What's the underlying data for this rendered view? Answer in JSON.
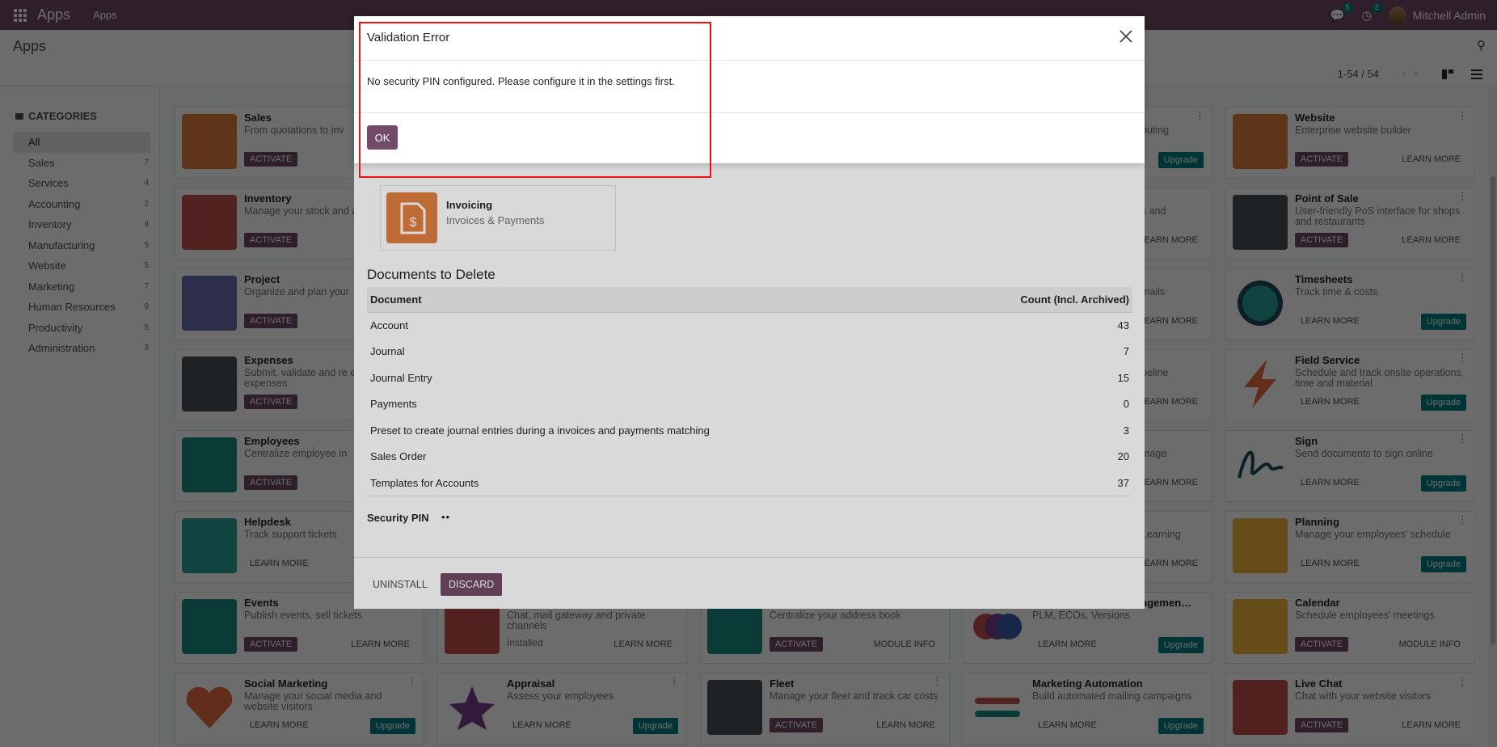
{
  "navbar": {
    "app": "Apps",
    "menu": "Apps",
    "chat_count": "5",
    "activity_count": "2",
    "user": "Mitchell Admin"
  },
  "control_panel": {
    "title": "Apps",
    "pager": "1-54 / 54"
  },
  "sidebar": {
    "heading": "CATEGORIES",
    "items": [
      {
        "label": "All",
        "count": ""
      },
      {
        "label": "Sales",
        "count": "7"
      },
      {
        "label": "Services",
        "count": "4"
      },
      {
        "label": "Accounting",
        "count": "2"
      },
      {
        "label": "Inventory",
        "count": "4"
      },
      {
        "label": "Manufacturing",
        "count": "5"
      },
      {
        "label": "Website",
        "count": "5"
      },
      {
        "label": "Marketing",
        "count": "7"
      },
      {
        "label": "Human Resources",
        "count": "9"
      },
      {
        "label": "Productivity",
        "count": "5"
      },
      {
        "label": "Administration",
        "count": "3"
      }
    ]
  },
  "apps": {
    "sales": {
      "title": "Sales",
      "desc": "From quotations to inv",
      "b1": "ACTIVATE"
    },
    "inventory": {
      "title": "Inventory",
      "desc": "Manage your stock and activities",
      "b1": "ACTIVATE"
    },
    "project": {
      "title": "Project",
      "desc": "Organize and plan your",
      "b1": "ACTIVATE"
    },
    "expenses": {
      "title": "Expenses",
      "desc": "Submit, validate and re employee expenses",
      "b1": "ACTIVATE"
    },
    "employees": {
      "title": "Employees",
      "desc": "Centralize employee in",
      "b1": "ACTIVATE"
    },
    "helpdesk": {
      "title": "Helpdesk",
      "desc": "Track support tickets",
      "b1": "LEARN MORE"
    },
    "events": {
      "title": "Events",
      "desc": "Publish events, sell tickets",
      "b1": "ACTIVATE",
      "b2": "LEARN MORE"
    },
    "social": {
      "title": "Social Marketing",
      "desc": "Manage your social media and website visitors",
      "b1": "LEARN MORE",
      "b2": "Upgrade"
    },
    "discuss": {
      "desc": "Chat, mail gateway and private channels",
      "status": "Installed",
      "b2": "LEARN MORE"
    },
    "appraisal": {
      "title": "Appraisal",
      "desc": "Assess your employees",
      "b1": "LEARN MORE",
      "b2": "Upgrade"
    },
    "contacts": {
      "desc": "Centralize your address book",
      "b1": "ACTIVATE",
      "b2": "MODULE INFO"
    },
    "fleet": {
      "title": "Fleet",
      "desc": "Manage your fleet and track car costs",
      "b1": "ACTIVATE",
      "b2": "LEARN MORE"
    },
    "plm": {
      "title": "agemen…",
      "desc": "PLM, ECOs, Versions",
      "b1": "LEARN MORE",
      "b2": "Upgrade"
    },
    "mktauto": {
      "title": "Marketing Automation",
      "desc": "Build automated mailing campaigns",
      "b1": "LEARN MORE",
      "b2": "Upgrade"
    },
    "c4r0": {
      "desc": "outing",
      "b2": "Upgrade"
    },
    "c4r1": {
      "desc": "s and",
      "b2": "EARN MORE"
    },
    "c4r2": {
      "desc": "mails",
      "b2": "EARN MORE"
    },
    "c4r3": {
      "desc": "peline",
      "b2": "EARN MORE"
    },
    "c4r4": {
      "desc": "mage",
      "b2": "EARN MORE"
    },
    "c4r5": {
      "desc": "Learning",
      "b2": "EARN MORE"
    },
    "website": {
      "title": "Website",
      "desc": "Enterprise website builder",
      "b1": "ACTIVATE",
      "b2": "LEARN MORE"
    },
    "pos": {
      "title": "Point of Sale",
      "desc": "User-friendly PoS interface for shops and restaurants",
      "b1": "ACTIVATE",
      "b2": "LEARN MORE"
    },
    "timesheets": {
      "title": "Timesheets",
      "desc": "Track time & costs",
      "b1": "LEARN MORE",
      "b2": "Upgrade"
    },
    "fieldservice": {
      "title": "Field Service",
      "desc": "Schedule and track onsite operations, time and material",
      "b1": "LEARN MORE",
      "b2": "Upgrade"
    },
    "sign": {
      "title": "Sign",
      "desc": "Send documents to sign online",
      "b1": "LEARN MORE",
      "b2": "Upgrade"
    },
    "planning": {
      "title": "Planning",
      "desc": "Manage your employees' schedule",
      "b1": "LEARN MORE",
      "b2": "Upgrade"
    },
    "calendar": {
      "title": "Calendar",
      "desc": "Schedule employees' meetings",
      "b1": "ACTIVATE",
      "b2": "MODULE INFO"
    },
    "livechat": {
      "title": "Live Chat",
      "desc": "Chat with your website visitors",
      "b1": "ACTIVATE",
      "b2": "LEARN MORE"
    }
  },
  "uninstall": {
    "app_title": "Invoicing",
    "app_desc": "Invoices & Payments",
    "docs_heading": "Documents to Delete",
    "col_document": "Document",
    "col_count": "Count (Incl. Archived)",
    "rows": [
      {
        "doc": "Account",
        "count": "43"
      },
      {
        "doc": "Journal",
        "count": "7"
      },
      {
        "doc": "Journal Entry",
        "count": "15"
      },
      {
        "doc": "Payments",
        "count": "0"
      },
      {
        "doc": "Preset to create journal entries during a invoices and payments matching",
        "count": "3"
      },
      {
        "doc": "Sales Order",
        "count": "20"
      },
      {
        "doc": "Templates for Accounts",
        "count": "37"
      }
    ],
    "pin_label": "Security PIN",
    "pin_value": "••",
    "uninstall_btn": "UNINSTALL",
    "discard_btn": "DISCARD"
  },
  "error_dialog": {
    "title": "Validation Error",
    "message": "No security PIN configured. Please configure it in the settings first.",
    "ok": "OK"
  },
  "colors": {
    "primary": "#714b67",
    "teal": "#017e84",
    "highlight": "#ee1111"
  }
}
